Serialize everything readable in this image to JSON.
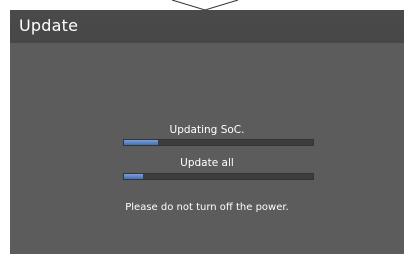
{
  "window": {
    "title": "Update"
  },
  "progress_items": [
    {
      "label": "Updating SoC.",
      "progress": 0.18
    },
    {
      "label": "Update all",
      "progress": 0.1
    }
  ],
  "notice": "Please do not turn off the power.",
  "colors": {
    "background": "#5c5c5c",
    "title_bar": "#484848",
    "progress_fill": "#5a86c8",
    "progress_track": "#3d3d3d",
    "text": "#ffffff"
  }
}
